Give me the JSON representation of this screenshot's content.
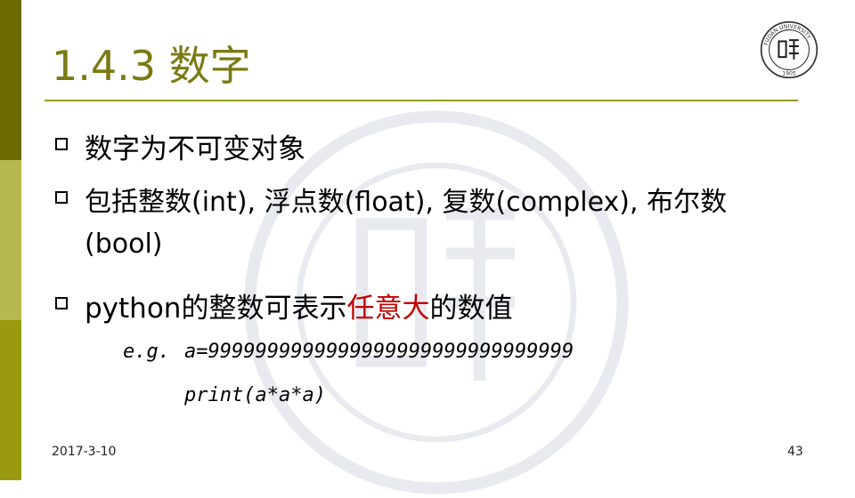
{
  "title": "1.4.3 数字",
  "bullets": [
    {
      "text": "数字为不可变对象"
    },
    {
      "text": "包括整数(int), 浮点数(float), 复数(complex), 布尔数",
      "continuation": "(bool)"
    },
    {
      "text_before": "python的整数可表示",
      "highlight": "任意大",
      "text_after": "的数值"
    }
  ],
  "example": {
    "label": "e.g.",
    "line1": "a=9999999999999999999999999999999",
    "line2": "print(a*a*a)"
  },
  "footer": {
    "date": "2017-3-10",
    "page": "43"
  },
  "colors": {
    "title": "#7a7a12",
    "accent": "#9a9a10",
    "highlight": "#c00000"
  },
  "logo": {
    "ring_text": "FUDAN UNIVERSITY",
    "year": "1905"
  }
}
